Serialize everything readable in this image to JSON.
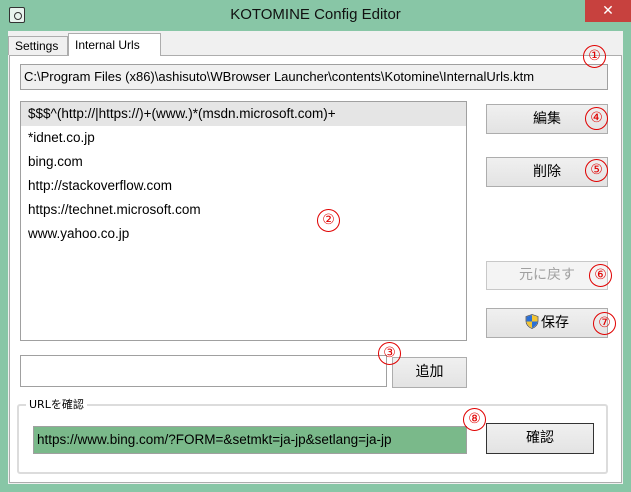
{
  "window": {
    "title": "KOTOMINE Config Editor",
    "close_glyph": "✕",
    "app_icon": "gear-icon",
    "accent_color": "#88c6a6"
  },
  "tabs": [
    {
      "label": "Settings",
      "active": false
    },
    {
      "label": "Internal Urls",
      "active": true
    }
  ],
  "path": "C:\\Program Files (x86)\\ashisuto\\WBrowser Launcher\\contents\\Kotomine\\InternalUrls.ktm",
  "url_list": {
    "items": [
      "$$$^(http://|https://)+(www.)*(msdn.microsoft.com)+",
      "*idnet.co.jp",
      "bing.com",
      "http://stackoverflow.com",
      "https://technet.microsoft.com",
      "www.yahoo.co.jp"
    ],
    "selected_index": 0
  },
  "buttons": {
    "edit": "編集",
    "delete": "削除",
    "undo": "元に戻す",
    "save": "保存",
    "add": "追加",
    "confirm": "確認"
  },
  "add_input": {
    "value": ""
  },
  "url_check": {
    "group_label": "URLを確認",
    "value": "https://www.bing.com/?FORM=&setmkt=ja-jp&setlang=ja-jp"
  },
  "markers": [
    "①",
    "②",
    "③",
    "④",
    "⑤",
    "⑥",
    "⑦",
    "⑧"
  ],
  "colors": {
    "marker": "#e00000",
    "check_field_bg": "#7ab98a",
    "close_button": "#c7413e"
  }
}
